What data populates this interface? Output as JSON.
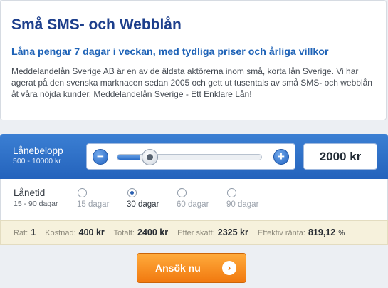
{
  "info": {
    "title": "Små SMS- och Webblån",
    "subtitle": "Låna pengar 7 dagar i veckan, med tydliga priser och årliga villkor",
    "body": "Meddelandelån Sverige AB är en av de äldsta aktörerna inom små, korta lån Sverige. Vi har agerat på den svenska marknacen sedan 2005 och gett ut tusentals av små SMS- och webblån åt våra nöjda kunder. Meddelandelån Sverige - Ett Enklare Lån!"
  },
  "amount": {
    "label": "Lånebelopp",
    "range": "500 - 10000 kr",
    "value": "2000 kr",
    "slider_fraction": 0.16,
    "minus_symbol": "−",
    "plus_symbol": "+"
  },
  "term": {
    "label": "Lånetid",
    "range": "15 - 90 dagar",
    "options": [
      {
        "label": "15 dagar",
        "selected": false
      },
      {
        "label": "30 dagar",
        "selected": true
      },
      {
        "label": "60 dagar",
        "selected": false
      },
      {
        "label": "90 dagar",
        "selected": false
      }
    ]
  },
  "summary": {
    "rat_label": "Rat:",
    "rat_value": "1",
    "cost_label": "Kostnad:",
    "cost_value": "400 kr",
    "total_label": "Totalt:",
    "total_value": "2400 kr",
    "after_tax_label": "Efter skatt:",
    "after_tax_value": "2325 kr",
    "rate_label": "Effektiv ränta:",
    "rate_value": "819,12",
    "rate_unit": "%"
  },
  "apply": {
    "label": "Ansök nu",
    "icon": "chevron-right-icon",
    "icon_glyph": "›"
  },
  "colors": {
    "title": "#1d3f8c",
    "subtitle": "#1f63b7",
    "panel_blue": "#2463bc",
    "button_orange": "#f1790f",
    "summary_bg": "#f6f1dc"
  }
}
